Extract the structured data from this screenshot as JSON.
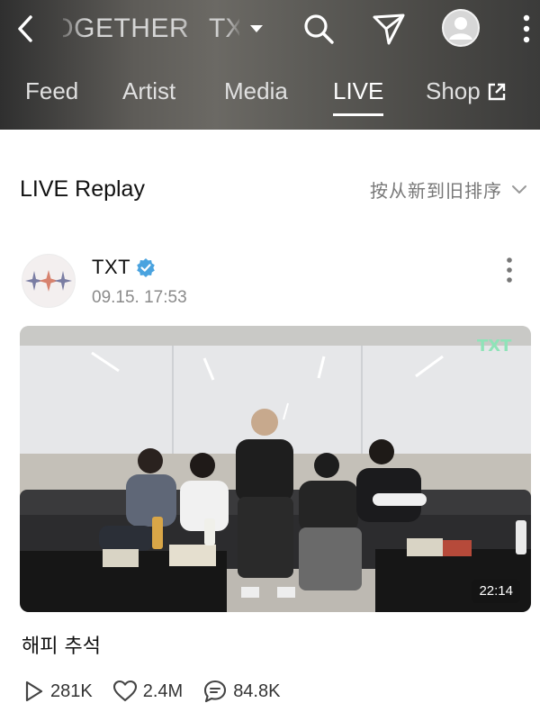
{
  "header": {
    "channel_title": "TOGETHER",
    "channel_switch_label": "TXT",
    "icons": {
      "back": "chevron-left-icon",
      "search": "search-icon",
      "send": "send-icon",
      "profile": "profile-icon",
      "more": "more-vertical-icon"
    }
  },
  "tabs": [
    {
      "label": "Feed",
      "active": false
    },
    {
      "label": "Artist",
      "active": false
    },
    {
      "label": "Media",
      "active": false
    },
    {
      "label": "LIVE",
      "active": true
    },
    {
      "label": "Shop",
      "active": false,
      "icon": "external-link-icon"
    }
  ],
  "section": {
    "title": "LIVE Replay",
    "sort_label": "按从新到旧排序"
  },
  "post": {
    "artist_name": "TXT",
    "verified": true,
    "time": "09.15. 17:53",
    "video": {
      "duration": "22:14",
      "watermark": "TXT"
    },
    "title": "해피 추석",
    "stats": {
      "plays": "281K",
      "likes": "2.4M",
      "comments": "84.8K"
    }
  },
  "colors": {
    "accent_verified": "#4aa3df",
    "header_bg": "#5a5955",
    "tab_active": "#ffffff"
  }
}
